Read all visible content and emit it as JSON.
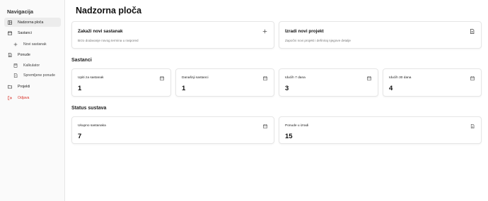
{
  "sidebar": {
    "title": "Navigacija",
    "items": [
      {
        "label": "Nadzorna ploča",
        "icon": "dashboard-icon"
      },
      {
        "label": "Sastanci",
        "icon": "calendar-icon"
      },
      {
        "label": "Novi sastanak",
        "icon": "plus-icon"
      },
      {
        "label": "Ponude",
        "icon": "document-icon"
      },
      {
        "label": "Kalkulator",
        "icon": "calculator-icon"
      },
      {
        "label": "Spremljene ponude",
        "icon": "saved-document-icon"
      },
      {
        "label": "Projekti",
        "icon": "folder-icon"
      },
      {
        "label": "Odjava",
        "icon": "logout-icon"
      }
    ]
  },
  "main": {
    "title": "Nadzorna ploča",
    "actions": [
      {
        "title": "Zakaži novi sastanak",
        "desc": "Brzo dodavanje novog termina u raspored",
        "icon": "plus-icon"
      },
      {
        "title": "Izradi novi projekt",
        "desc": "Započni novi projekt i definiraj njegove detalje",
        "icon": "document-icon"
      }
    ],
    "meetings": {
      "title": "Sastanci",
      "stats": [
        {
          "label": "Upiti za sastanak",
          "value": "1",
          "icon": "calendar-icon"
        },
        {
          "label": "Današnji sastanci",
          "value": "1",
          "icon": "calendar-icon"
        },
        {
          "label": "Idućih 7 dana",
          "value": "3",
          "icon": "calendar-icon"
        },
        {
          "label": "Idućih 30 dana",
          "value": "4",
          "icon": "calendar-icon"
        }
      ]
    },
    "system": {
      "title": "Status sustava",
      "stats": [
        {
          "label": "Ukupno sastanaka",
          "value": "7",
          "icon": "calendar-icon"
        },
        {
          "label": "Ponude u izradi",
          "value": "15",
          "icon": "document-icon"
        }
      ]
    }
  },
  "colors": {
    "sidebar_bg": "#fafafa",
    "active_bg": "#ececec",
    "logout": "#d9342b",
    "border": "#e6e6e6"
  }
}
